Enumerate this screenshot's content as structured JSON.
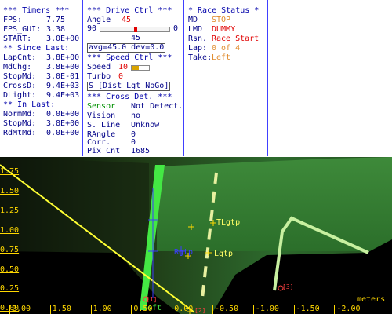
{
  "timers": {
    "title": "*** Timers ***",
    "rows": [
      {
        "label": "FPS:",
        "value": "7.75"
      },
      {
        "label": "FPS_GUI:",
        "value": "3.38"
      },
      {
        "label": "START:",
        "value": "3.0E+00"
      }
    ],
    "since_title": "** Since Last:",
    "since_rows": [
      {
        "label": "LapCnt:",
        "value": "3.8E+00"
      },
      {
        "label": "MdChg:",
        "value": "3.8E+00"
      },
      {
        "label": "StopMd:",
        "value": "3.0E-01"
      },
      {
        "label": "CrossD:",
        "value": "9.4E+03"
      },
      {
        "label": "DLight:",
        "value": "9.4E+03"
      }
    ],
    "in_title": "** In Last:",
    "in_rows": [
      {
        "label": "NormMd:",
        "value": "0.0E+00"
      },
      {
        "label": "StopMd:",
        "value": "3.8E+00"
      },
      {
        "label": "RdMtMd:",
        "value": "0.0E+00"
      }
    ]
  },
  "drive": {
    "title": "***  Drive Ctrl  ***",
    "angle_label": "Angle",
    "angle_value": "45",
    "slider_min": "90",
    "slider_max": "0",
    "slider_value": "45",
    "slider_fraction": 0.5,
    "stats": "avg=45.0  dev=0.0",
    "speed_title": "***  Speed Ctrl  ***",
    "speed_label": "Speed",
    "speed_value": "10",
    "speed_fraction": 0.4,
    "turbo_label": "Turbo",
    "turbo_value": "0",
    "mode_box": "S [Dist Lgt NoGo]",
    "cross_title": "*** Cross Det. ***",
    "cross_rows": [
      {
        "label": "Sensor",
        "value": "Not Detect.",
        "label_color": "#009000"
      },
      {
        "label": "Vision",
        "value": "no"
      },
      {
        "label": "S. Line",
        "value": "Unknow"
      },
      {
        "label": "RAngle",
        "value": "0"
      },
      {
        "label": "Corr.",
        "value": "0"
      },
      {
        "label": "Pix Cnt",
        "value": "1685"
      }
    ]
  },
  "race": {
    "title": "* Race Status *",
    "rows": [
      {
        "label": "MD",
        "value": "STOP",
        "color": "#e08a2a"
      },
      {
        "label": "LMD",
        "value": "DUMMY",
        "color": "#e00000"
      },
      {
        "label": "Rsn.",
        "value": "Race Start",
        "color": "#e00000"
      },
      {
        "label": "Lap:",
        "value": "0 of 4",
        "color": "#e08a2a"
      },
      {
        "label": "Take:",
        "value": "Left",
        "color": "#e08a2a"
      }
    ]
  },
  "camera": {
    "y_ticks": [
      "1.75",
      "1.50",
      "1.25",
      "1.00",
      "0.75",
      "0.50",
      "0.25",
      "0.00"
    ],
    "x_ticks": [
      "2.00",
      "1.50",
      "1.00",
      "0.50",
      "0.00",
      "-0.50",
      "-1.00",
      "-1.50",
      "-2.00"
    ],
    "units": "meters",
    "labels": {
      "tl": "TLgtp",
      "lgtp": "Lgtp",
      "left": "Left",
      "rgtp": "Rgtp",
      "pt1": "[1]",
      "pt2": "[2]",
      "pt3": "[3]"
    },
    "colors": {
      "axis": "#ffd800",
      "laneLeft": "#44e844",
      "marker": "#ff6a00",
      "point": "#ff4040",
      "crosshair": "#ffff66"
    }
  }
}
